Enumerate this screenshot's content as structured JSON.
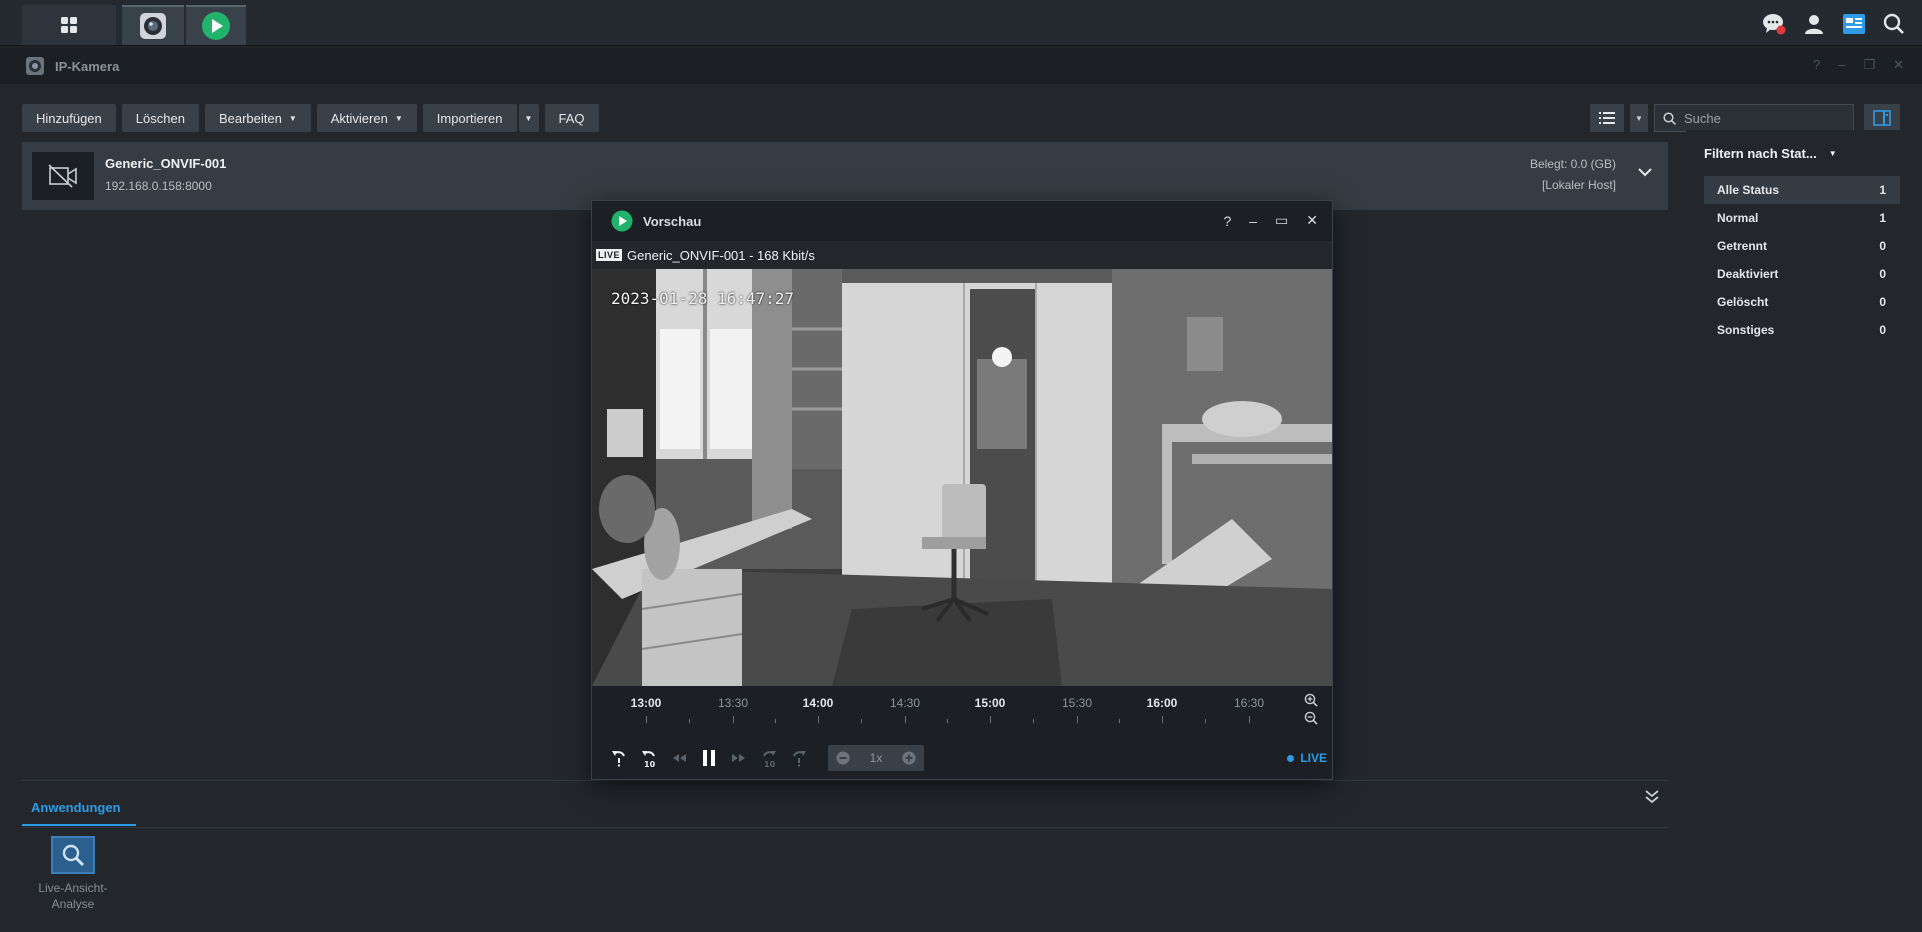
{
  "taskbar": {
    "apps": [
      {
        "icon": "grid-icon"
      },
      {
        "icon": "camera-app-icon",
        "active": true
      },
      {
        "icon": "play-app-icon",
        "active": true
      }
    ],
    "right_icons": [
      "chat-notification-icon",
      "user-icon",
      "widgets-icon",
      "search-icon"
    ]
  },
  "window": {
    "title": "IP-Kamera",
    "controls": [
      "?",
      "–",
      "❐",
      "✕"
    ]
  },
  "toolbar": {
    "add": "Hinzufügen",
    "delete": "Löschen",
    "edit": "Bearbeiten",
    "activate": "Aktivieren",
    "import": "Importieren",
    "faq": "FAQ"
  },
  "search": {
    "placeholder": "Suche"
  },
  "camera": {
    "name": "Generic_ONVIF-001",
    "ip": "192.168.0.158:8000",
    "used": "Belegt: 0.0 (GB)",
    "host": "[Lokaler Host]"
  },
  "filter": {
    "title": "Filtern nach Stat...",
    "items": [
      {
        "label": "Alle Status",
        "count": "1",
        "active": true
      },
      {
        "label": "Normal",
        "count": "1"
      },
      {
        "label": "Getrennt",
        "count": "0"
      },
      {
        "label": "Deaktiviert",
        "count": "0"
      },
      {
        "label": "Gelöscht",
        "count": "0"
      },
      {
        "label": "Sonstiges",
        "count": "0"
      }
    ]
  },
  "apps": {
    "tab": "Anwendungen",
    "items": [
      {
        "label": "Live-Ansicht-Analyse"
      }
    ]
  },
  "preview": {
    "title": "Vorschau",
    "controls": [
      "?",
      "–",
      "▭",
      "✕"
    ],
    "live_badge": "LIVE",
    "stream": "Generic_ONVIF-001 - 168 Kbit/s",
    "timestamp": "2023-01-28  16:47:27",
    "timeline": [
      "13:00",
      "13:30",
      "14:00",
      "14:30",
      "15:00",
      "15:30",
      "16:00",
      "16:30"
    ],
    "speed": "1x",
    "live_label": "LIVE"
  },
  "colors": {
    "accent": "#2e9be6",
    "play_green": "#21b36b",
    "notification_red": "#e23b3b"
  }
}
